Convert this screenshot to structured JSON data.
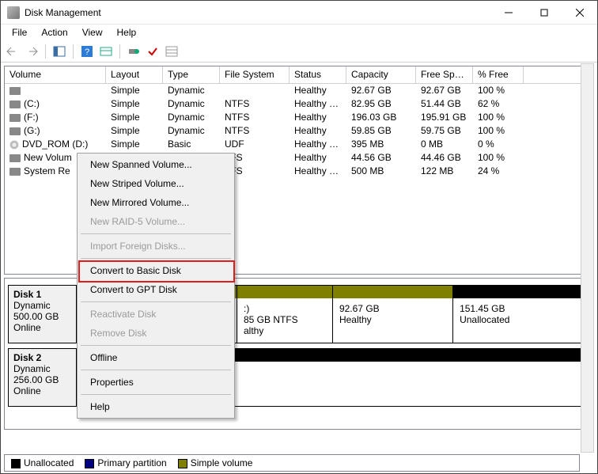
{
  "window": {
    "title": "Disk Management"
  },
  "menu": {
    "file": "File",
    "action": "Action",
    "view": "View",
    "help": "Help"
  },
  "columns": {
    "volume": "Volume",
    "layout": "Layout",
    "type": "Type",
    "fs": "File System",
    "status": "Status",
    "capacity": "Capacity",
    "free": "Free Spa...",
    "pctfree": "% Free"
  },
  "volumes": [
    {
      "name": "",
      "icon": "vol",
      "layout": "Simple",
      "type": "Dynamic",
      "fs": "",
      "status": "Healthy",
      "capacity": "92.67 GB",
      "free": "92.67 GB",
      "pct": "100 %"
    },
    {
      "name": "(C:)",
      "icon": "vol",
      "layout": "Simple",
      "type": "Dynamic",
      "fs": "NTFS",
      "status": "Healthy (B...",
      "capacity": "82.95 GB",
      "free": "51.44 GB",
      "pct": "62 %"
    },
    {
      "name": "(F:)",
      "icon": "vol",
      "layout": "Simple",
      "type": "Dynamic",
      "fs": "NTFS",
      "status": "Healthy",
      "capacity": "196.03 GB",
      "free": "195.91 GB",
      "pct": "100 %"
    },
    {
      "name": "(G:)",
      "icon": "vol",
      "layout": "Simple",
      "type": "Dynamic",
      "fs": "NTFS",
      "status": "Healthy",
      "capacity": "59.85 GB",
      "free": "59.75 GB",
      "pct": "100 %"
    },
    {
      "name": "DVD_ROM (D:)",
      "icon": "cd",
      "layout": "Simple",
      "type": "Basic",
      "fs": "UDF",
      "status": "Healthy (P...",
      "capacity": "395 MB",
      "free": "0 MB",
      "pct": "0 %"
    },
    {
      "name": "New Volum",
      "icon": "vol",
      "layout": "",
      "type": "",
      "fs": "TFS",
      "status": "Healthy",
      "capacity": "44.56 GB",
      "free": "44.46 GB",
      "pct": "100 %"
    },
    {
      "name": "System Re",
      "icon": "vol",
      "layout": "",
      "type": "",
      "fs": "TFS",
      "status": "Healthy (S...",
      "capacity": "500 MB",
      "free": "122 MB",
      "pct": "24 %"
    }
  ],
  "context_menu": {
    "items": [
      {
        "label": "New Spanned Volume...",
        "enabled": true
      },
      {
        "label": "New Striped Volume...",
        "enabled": true
      },
      {
        "label": "New Mirrored Volume...",
        "enabled": true
      },
      {
        "label": "New RAID-5 Volume...",
        "enabled": false
      },
      {
        "sep": true
      },
      {
        "label": "Import Foreign Disks...",
        "enabled": false
      },
      {
        "sep": true
      },
      {
        "label": "Convert to Basic Disk",
        "enabled": true,
        "highlight": true
      },
      {
        "label": "Convert to GPT Disk",
        "enabled": true
      },
      {
        "sep": true
      },
      {
        "label": "Reactivate Disk",
        "enabled": false
      },
      {
        "label": "Remove Disk",
        "enabled": false
      },
      {
        "sep": true
      },
      {
        "label": "Offline",
        "enabled": true
      },
      {
        "sep": true
      },
      {
        "label": "Properties",
        "enabled": true
      },
      {
        "sep": true
      },
      {
        "label": "Help",
        "enabled": true
      }
    ]
  },
  "disks": [
    {
      "name": "Disk 1",
      "type": "Dynamic",
      "size": "500.00 GB",
      "status": "Online",
      "parts": [
        {
          "kind": "simple",
          "label": ":)",
          "line2": "85 GB NTFS",
          "line3": "althy",
          "flex": 20
        },
        {
          "kind": "simple",
          "label": "",
          "line2": "92.67 GB",
          "line3": "Healthy",
          "flex": 26
        },
        {
          "kind": "unalloc",
          "label": "",
          "line2": "151.45 GB",
          "line3": "Unallocated",
          "flex": 30
        }
      ]
    },
    {
      "name": "Disk 2",
      "type": "Dynamic",
      "size": "256.00 GB",
      "status": "Online",
      "parts": [
        {
          "kind": "unalloc",
          "label": "",
          "line2": "",
          "line3": "Unallocated",
          "flex": 100
        }
      ]
    }
  ],
  "legend": {
    "unallocated": "Unallocated",
    "primary": "Primary partition",
    "simple": "Simple volume"
  }
}
